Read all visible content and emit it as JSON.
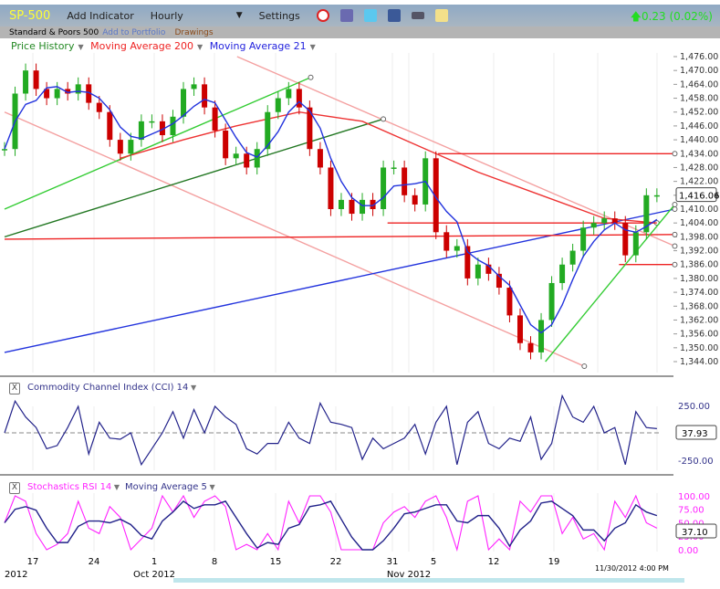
{
  "toolbar": {
    "symbol": "SP-500",
    "add_indicator": "Add Indicator",
    "interval": "Hourly",
    "settings": "Settings",
    "change": "0.23 (0.02%)",
    "icons": [
      "alarm-clock-icon",
      "database-icon",
      "twitter-icon",
      "facebook-icon",
      "camera-icon",
      "note-icon"
    ]
  },
  "subbar": {
    "name": "Standard & Poors 500",
    "add_portfolio": "Add to Portfolio",
    "drawings": "Drawings"
  },
  "legend": {
    "price": "Price History",
    "ma200": "Moving Average 200",
    "ma21": "Moving Average 21"
  },
  "colors": {
    "price_up": "#22aa22",
    "price_down": "#cc0000",
    "ma200": "#e33",
    "ma21": "#2233dd",
    "cci": "#22228a",
    "stoch": "#ff22ff"
  },
  "price_axis": {
    "ticks": [
      "1,476.00",
      "1,470.00",
      "1,464.00",
      "1,458.00",
      "1,452.00",
      "1,446.00",
      "1,440.00",
      "1,434.00",
      "1,428.00",
      "1,422.00",
      "1,416.00",
      "1,410.00",
      "1,404.00",
      "1,398.00",
      "1,392.00",
      "1,386.00",
      "1,380.00",
      "1,374.00",
      "1,368.00",
      "1,362.00",
      "1,356.00",
      "1,350.00",
      "1,344.00"
    ],
    "last": "1,416.06",
    "min": 1344,
    "max": 1476
  },
  "closes": [
    1436,
    1460,
    1470,
    1462,
    1458,
    1462,
    1460,
    1464,
    1456,
    1452,
    1440,
    1434,
    1440,
    1448,
    1448,
    1442,
    1450,
    1462,
    1464,
    1454,
    1444,
    1432,
    1434,
    1428,
    1436,
    1452,
    1458,
    1462,
    1454,
    1436,
    1428,
    1410,
    1414,
    1408,
    1414,
    1410,
    1428,
    1428,
    1416,
    1412,
    1432,
    1400,
    1392,
    1394,
    1380,
    1386,
    1382,
    1376,
    1364,
    1352,
    1348,
    1362,
    1378,
    1386,
    1392,
    1402,
    1404,
    1406,
    1404,
    1390,
    1400,
    1416,
    1416
  ],
  "ma200": [
    [
      11,
      1432
    ],
    [
      17,
      1440
    ],
    [
      22,
      1446
    ],
    [
      28,
      1452
    ],
    [
      34,
      1448
    ],
    [
      39,
      1438
    ],
    [
      45,
      1426
    ],
    [
      51,
      1416
    ],
    [
      57,
      1406
    ],
    [
      62,
      1404
    ]
  ],
  "trendlines": [
    {
      "c": "#f4a0a0",
      "p": [
        [
          22.1,
          1476
        ],
        [
          63.7,
          1394
        ]
      ]
    },
    {
      "c": "#f4a0a0",
      "p": [
        [
          0,
          1452
        ],
        [
          55.1,
          1342
        ]
      ]
    },
    {
      "c": "#33cc33",
      "p": [
        [
          0,
          1410
        ],
        [
          29.1,
          1467
        ]
      ]
    },
    {
      "c": "#227722",
      "p": [
        [
          0,
          1398
        ],
        [
          36,
          1449
        ]
      ]
    },
    {
      "c": "#2233dd",
      "p": [
        [
          0,
          1348
        ],
        [
          63.7,
          1410
        ]
      ]
    },
    {
      "c": "#ee2222",
      "p": [
        [
          0,
          1397
        ],
        [
          63.7,
          1399
        ]
      ]
    },
    {
      "c": "#ee2222",
      "p": [
        [
          41.2,
          1434
        ],
        [
          63.7,
          1434
        ]
      ]
    },
    {
      "c": "#ee2222",
      "p": [
        [
          36.4,
          1404
        ],
        [
          62,
          1404
        ]
      ]
    },
    {
      "c": "#ee2222",
      "p": [
        [
          58.4,
          1386
        ],
        [
          63.7,
          1386
        ]
      ]
    },
    {
      "c": "#33cc33",
      "p": [
        [
          51.4,
          1344
        ],
        [
          63.7,
          1412
        ]
      ]
    }
  ],
  "cci": {
    "title": "Commodity Channel Index (CCI) 14",
    "ticks": [
      "250.00",
      "-250.00"
    ],
    "last": "37.93",
    "values": [
      0,
      300,
      150,
      50,
      -150,
      -120,
      50,
      250,
      -200,
      100,
      -50,
      -60,
      0,
      -300,
      -150,
      0,
      200,
      -50,
      220,
      0,
      250,
      150,
      80,
      -150,
      -200,
      -100,
      -100,
      100,
      -50,
      -100,
      280,
      100,
      80,
      50,
      -250,
      -50,
      -150,
      -100,
      -50,
      80,
      -200,
      100,
      250,
      -300,
      100,
      200,
      -100,
      -150,
      -50,
      -80,
      150,
      -250,
      -100,
      350,
      150,
      100,
      250,
      0,
      50,
      -300,
      200,
      50,
      40
    ]
  },
  "stoch": {
    "title": "Stochastics RSI 14",
    "ma_title": "Moving Average 5",
    "ticks": [
      "100.00",
      "75.00",
      "50.00",
      "25.00",
      "0.00"
    ],
    "last": "37.10",
    "values": [
      50,
      100,
      90,
      30,
      0,
      10,
      30,
      90,
      40,
      30,
      80,
      60,
      0,
      20,
      40,
      100,
      70,
      100,
      60,
      90,
      100,
      80,
      0,
      10,
      0,
      30,
      0,
      90,
      50,
      100,
      100,
      70,
      0,
      0,
      0,
      0,
      50,
      70,
      80,
      60,
      90,
      100,
      60,
      0,
      90,
      100,
      0,
      20,
      0,
      90,
      70,
      100,
      100,
      30,
      60,
      20,
      30,
      0,
      90,
      60,
      100,
      50,
      40
    ]
  },
  "date_axis": {
    "labels": [
      "17",
      "24",
      "1",
      "8",
      "15",
      "22",
      "31",
      "5",
      "12",
      "19"
    ],
    "months": [
      "2012",
      "Oct 2012",
      "Nov 2012"
    ],
    "timestamp": "11/30/2012 4:00 PM"
  }
}
